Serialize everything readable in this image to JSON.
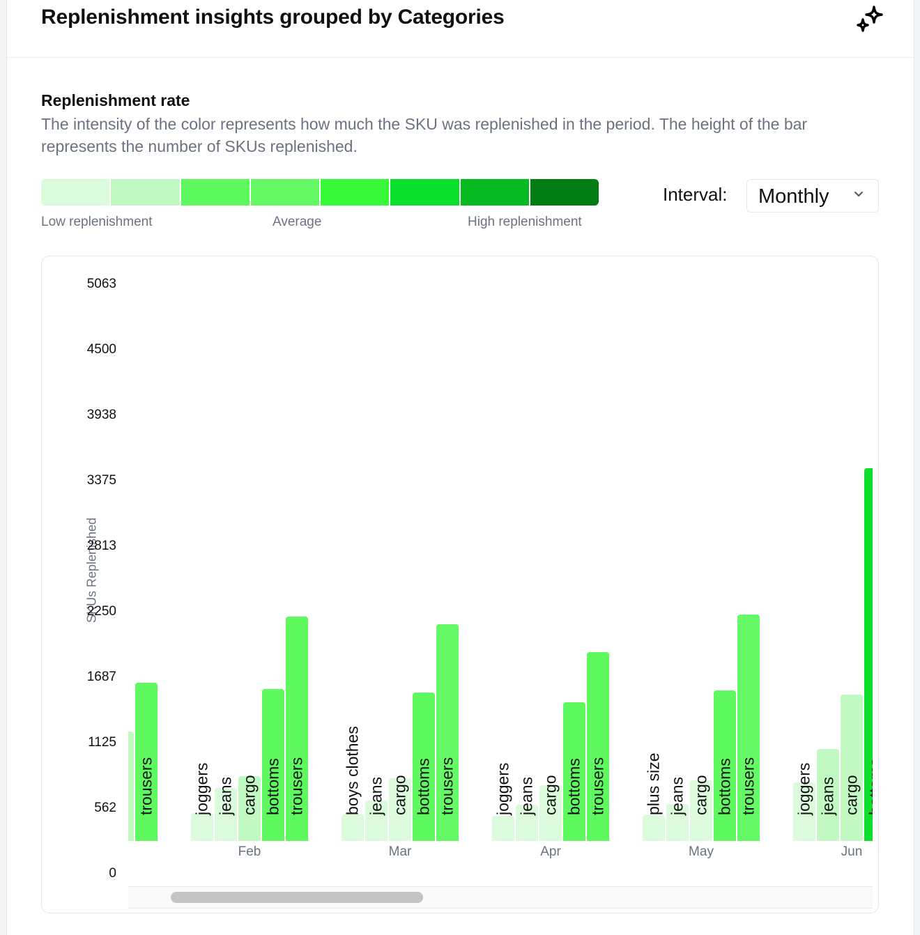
{
  "header": {
    "title": "Replenishment insights grouped by Categories",
    "icon": "sparkles-icon"
  },
  "section": {
    "title": "Replenishment rate",
    "description": "The intensity of the color represents how much the SKU was replenished in the period. The height of the bar represents the number of SKUs replenished."
  },
  "legend": {
    "colors": [
      "#dcfadc",
      "#c2f8c2",
      "#5ef95e",
      "#66f966",
      "#37f937",
      "#0ce02c",
      "#07ba22",
      "#027d14"
    ],
    "low_label": "Low replenishment",
    "mid_label": "Average",
    "high_label": "High replenishment"
  },
  "interval": {
    "label": "Interval:",
    "value": "Monthly"
  },
  "chart_data": {
    "type": "bar",
    "ylabel": "SKUs Replenished",
    "ylim": [
      0,
      5063
    ],
    "yticks": [
      "0",
      "562",
      "1125",
      "1687",
      "2250",
      "2813",
      "3375",
      "3938",
      "4500",
      "5063"
    ],
    "grid": false,
    "groups": [
      {
        "month": "",
        "bars": [
          {
            "category": "",
            "value": 1221,
            "level": 2
          },
          {
            "category": "trousers",
            "value": 1640,
            "level": 3
          }
        ]
      },
      {
        "month": "Feb",
        "bars": [
          {
            "category": "joggers",
            "value": 521,
            "level": 1
          },
          {
            "category": "jeans",
            "value": 736,
            "level": 1
          },
          {
            "category": "cargo",
            "value": 838,
            "level": 2
          },
          {
            "category": "bottoms",
            "value": 1586,
            "level": 3
          },
          {
            "category": "trousers",
            "value": 2208,
            "level": 3
          }
        ]
      },
      {
        "month": "Mar",
        "bars": [
          {
            "category": "boys clothes",
            "value": 509,
            "level": 1
          },
          {
            "category": "jeans",
            "value": 628,
            "level": 1
          },
          {
            "category": "cargo",
            "value": 820,
            "level": 1
          },
          {
            "category": "bottoms",
            "value": 1556,
            "level": 3
          },
          {
            "category": "trousers",
            "value": 2142,
            "level": 4
          }
        ]
      },
      {
        "month": "Apr",
        "bars": [
          {
            "category": "joggers",
            "value": 497,
            "level": 1
          },
          {
            "category": "jeans",
            "value": 592,
            "level": 1
          },
          {
            "category": "cargo",
            "value": 760,
            "level": 1
          },
          {
            "category": "bottoms",
            "value": 1472,
            "level": 3
          },
          {
            "category": "trousers",
            "value": 1903,
            "level": 3
          }
        ]
      },
      {
        "month": "May",
        "bars": [
          {
            "category": "plus size",
            "value": 503,
            "level": 1
          },
          {
            "category": "jeans",
            "value": 598,
            "level": 1
          },
          {
            "category": "cargo",
            "value": 802,
            "level": 1
          },
          {
            "category": "bottoms",
            "value": 1574,
            "level": 3
          },
          {
            "category": "trousers",
            "value": 2226,
            "level": 4
          }
        ]
      },
      {
        "month": "Jun",
        "bars": [
          {
            "category": "joggers",
            "value": 784,
            "level": 1
          },
          {
            "category": "jeans",
            "value": 1071,
            "level": 2
          },
          {
            "category": "cargo",
            "value": 1538,
            "level": 2
          },
          {
            "category": "bottoms",
            "value": 3483,
            "level": 6
          }
        ]
      }
    ]
  }
}
